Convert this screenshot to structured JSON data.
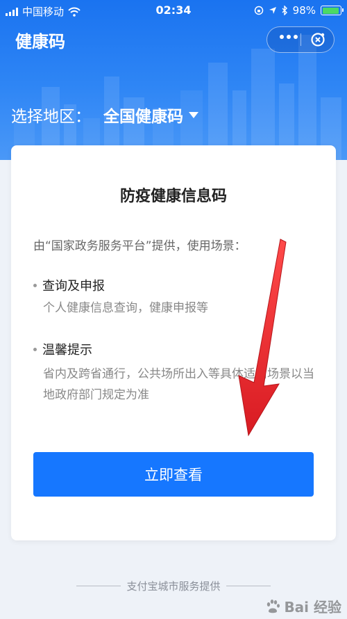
{
  "status_bar": {
    "carrier": "中国移动",
    "time": "02:34",
    "battery": "98%",
    "battery_level": 0.98
  },
  "nav": {
    "title": "健康码",
    "more_icon": "more-dots-icon",
    "close_icon": "close-circle-icon"
  },
  "region": {
    "label": "选择地区：",
    "value": "全国健康码"
  },
  "card": {
    "title": "防疫健康信息码",
    "intro": "由“国家政务服务平台”提供，使用场景：",
    "sections": [
      {
        "title": "查询及申报",
        "desc": "个人健康信息查询，健康申报等"
      },
      {
        "title": "温馨提示",
        "desc": "省内及跨省通行，公共场所出入等具体适用场景以当地政府部门规定为准"
      }
    ],
    "button_label": "立即查看"
  },
  "footer": {
    "text": "支付宝城市服务提供"
  },
  "watermark": {
    "text": "Bai  经验"
  },
  "colors": {
    "accent": "#1677ff",
    "header_top": "#1a73f0",
    "arrow": "#e8232b"
  }
}
